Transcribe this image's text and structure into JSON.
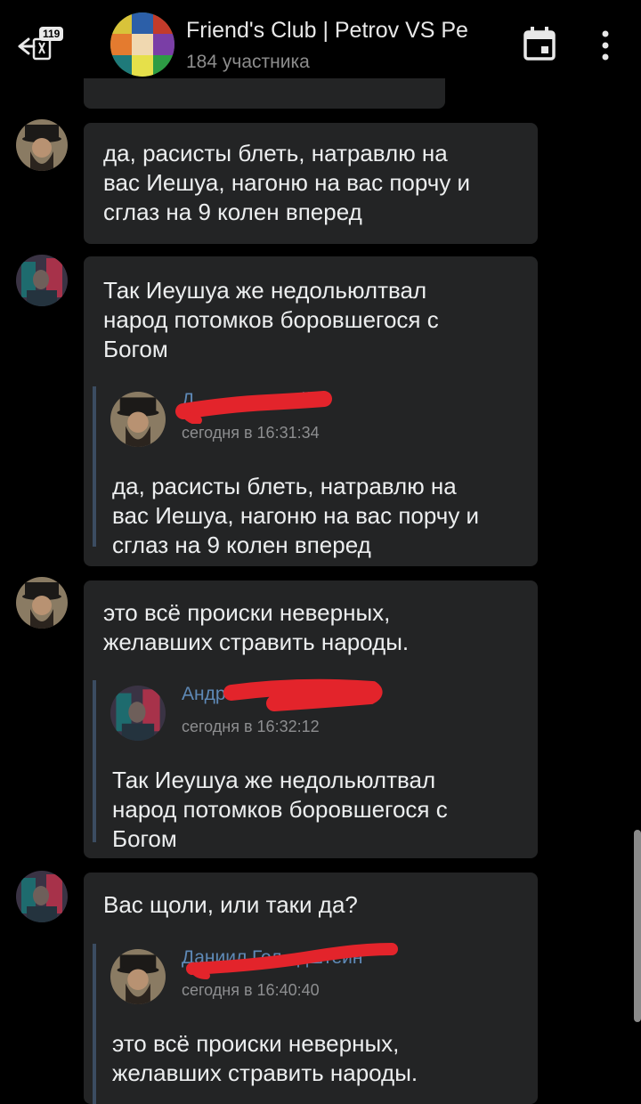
{
  "header": {
    "back_badge": "119",
    "title": "Friend's Club | Petrov VS Pe",
    "subtitle": "184 участника",
    "calendar_icon": "calendar-icon",
    "more_icon": "more-vertical-icon"
  },
  "messages": [
    {
      "text_lines": [
        "да, расисты блеть, натравлю на",
        "вас Иешуа, нагоню на вас порчу и",
        "сглаз на 9 колен вперед"
      ]
    },
    {
      "text_lines": [
        "Так Иеушуа же недольюлтвал",
        "народ потомков боровшегося с",
        "Богом"
      ],
      "quote": {
        "name": "Д              штейн",
        "time": "сегодня в 16:31:34",
        "text_lines": [
          "да, расисты блеть, натравлю на",
          "вас Иешуа, нагоню на вас порчу и",
          "сглаз на 9 колен вперед"
        ]
      }
    },
    {
      "text_lines": [
        "это всё происки неверных,",
        "желавших стравить народы."
      ],
      "quote": {
        "name": "Андре",
        "time": "сегодня в 16:32:12",
        "text_lines": [
          "Так Иеушуа же недольюлтвал",
          "народ потомков боровшегося с",
          "Богом"
        ]
      }
    },
    {
      "text_lines": [
        "Вас щоли, или таки да?"
      ],
      "quote": {
        "name": "Даниил Гол   дштейн",
        "time": "сегодня в 16:40:40",
        "text_lines": [
          "это всё происки неверных,",
          "желавших стравить народы."
        ]
      }
    }
  ],
  "colors": {
    "background": "#000000",
    "bubble": "#232425",
    "quote_name": "#5e89b6",
    "quote_bar": "#3b4c61",
    "redaction": "#e3242b"
  }
}
